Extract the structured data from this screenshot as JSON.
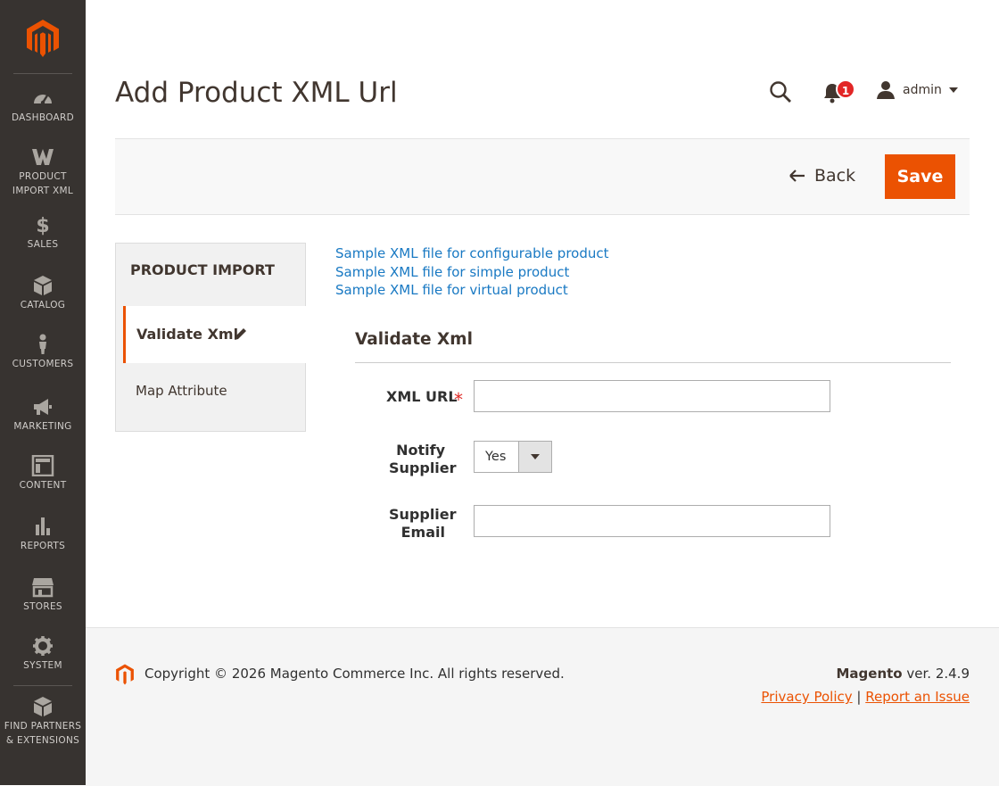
{
  "sidebar": {
    "items": [
      {
        "label": "DASHBOARD",
        "icon": "dashboard-icon"
      },
      {
        "label": "PRODUCT IMPORT XML",
        "icon": "product-import-icon"
      },
      {
        "label": "SALES",
        "icon": "dollar-icon"
      },
      {
        "label": "CATALOG",
        "icon": "box-icon"
      },
      {
        "label": "CUSTOMERS",
        "icon": "person-icon"
      },
      {
        "label": "MARKETING",
        "icon": "megaphone-icon"
      },
      {
        "label": "CONTENT",
        "icon": "layout-icon"
      },
      {
        "label": "REPORTS",
        "icon": "bar-chart-icon"
      },
      {
        "label": "STORES",
        "icon": "store-icon"
      },
      {
        "label": "SYSTEM",
        "icon": "gear-icon"
      },
      {
        "label": "FIND PARTNERS & EXTENSIONS",
        "icon": "extensions-icon"
      }
    ]
  },
  "header": {
    "title": "Add Product XML Url",
    "notification_count": "1",
    "user": "admin"
  },
  "actions": {
    "back_label": "Back",
    "save_label": "Save"
  },
  "tabs": {
    "title": "PRODUCT IMPORT",
    "items": [
      {
        "label": "Validate Xml",
        "active": true
      },
      {
        "label": "Map Attribute",
        "active": false
      }
    ]
  },
  "sample_links": [
    "Sample XML file for configurable product",
    "Sample XML file for simple product",
    "Sample XML file for virtual product"
  ],
  "form": {
    "fieldset_title": "Validate Xml",
    "xml_url": {
      "label": "XML URL",
      "value": ""
    },
    "notify_supplier": {
      "label_line1": "Notify",
      "label_line2": "Supplier",
      "value": "Yes"
    },
    "supplier_email": {
      "label_line1": "Supplier",
      "label_line2": "Email",
      "value": ""
    }
  },
  "footer": {
    "copyright": "Copyright © 2026 Magento Commerce Inc. All rights reserved.",
    "brand": "Magento",
    "version": " ver. 2.4.9",
    "privacy": "Privacy Policy",
    "separator": "|",
    "report": "Report an Issue"
  },
  "colors": {
    "accent": "#eb5202",
    "sidebar_bg": "#373330",
    "link": "#1979c3"
  }
}
